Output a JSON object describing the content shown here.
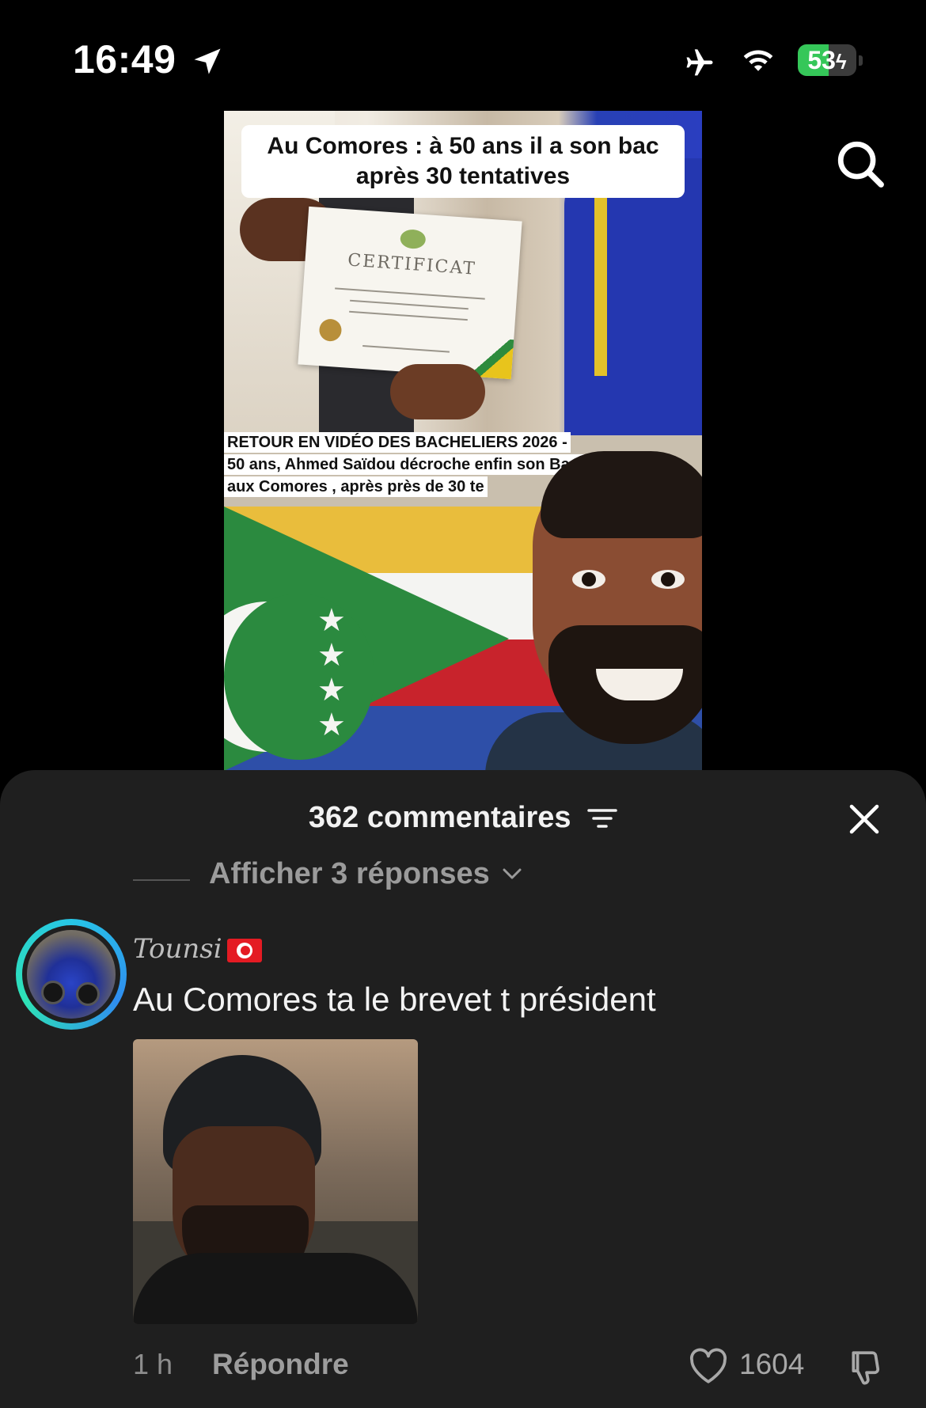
{
  "status_bar": {
    "time": "16:49",
    "battery_percent": "53",
    "battery_level": 0.53,
    "icons": [
      "location-arrow-icon",
      "airplane-icon",
      "wifi-icon",
      "battery-charging-icon"
    ]
  },
  "video": {
    "caption": "Au Comores : à 50 ans il a son bac après 30 tentatives",
    "certificate_title": "CERTIFICAT",
    "headline_lines": [
      "RETOUR EN VIDÉO DES BACHELIERS 2026 -",
      "50 ans, Ahmed Saïdou décroche enfin son Baccalauré",
      "aux Comores , après près de 30 te"
    ]
  },
  "comments_sheet": {
    "title": "362 commentaires",
    "replies_toggle": "Afficher 3 réponses",
    "comment": {
      "username": "Tounsi",
      "text": "Au Comores ta le brevet t président",
      "time_ago": "1 h",
      "reply_label": "Répondre",
      "likes": "1604"
    }
  },
  "colors": {
    "background": "#000000",
    "sheet": "#1f1f1f",
    "battery_green": "#35c759",
    "avatar_ring": "#27c6e6"
  }
}
